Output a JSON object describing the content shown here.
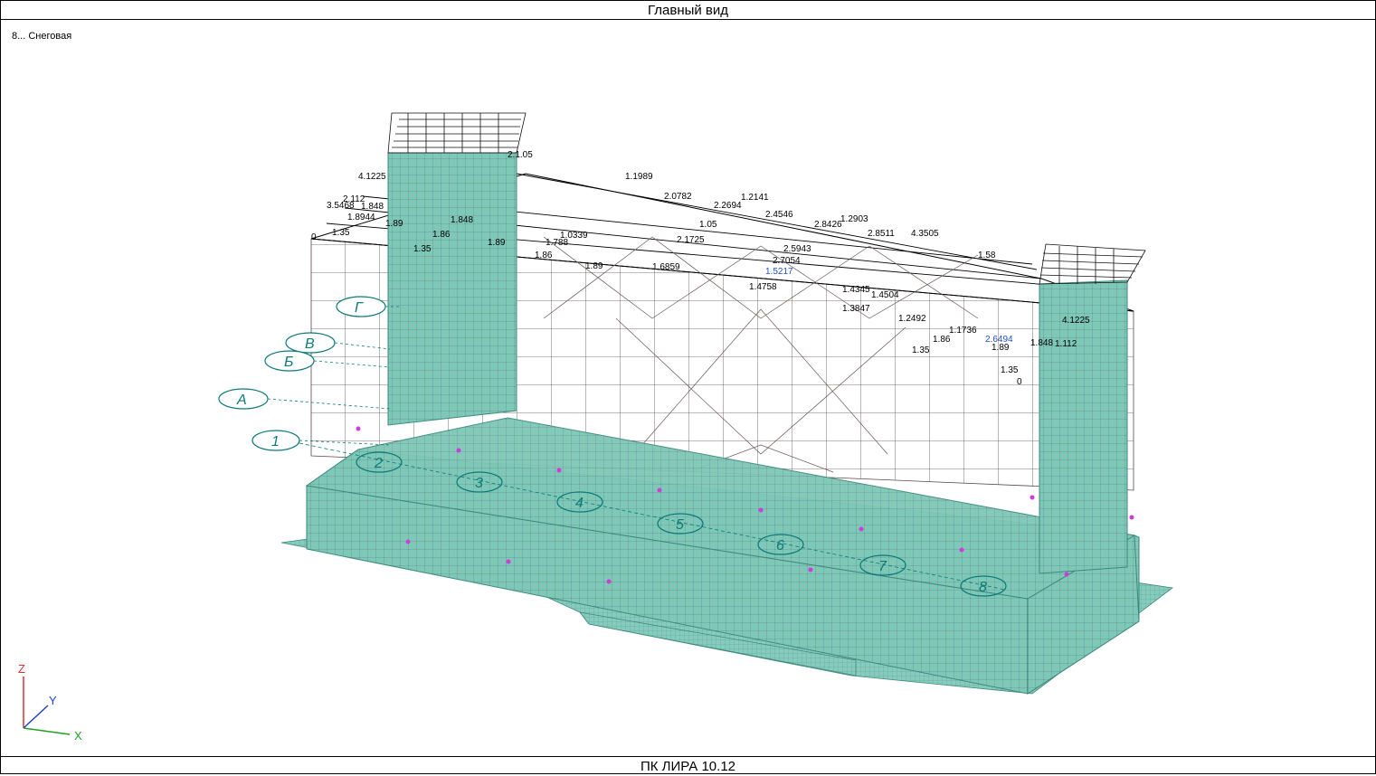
{
  "window": {
    "title": "Главный вид"
  },
  "status": {
    "product": "ПК ЛИРА 10.12"
  },
  "viewport": {
    "load_case": "8... Снеговая",
    "axes": {
      "z": "Z",
      "y": "Y",
      "x": "X",
      "colors": {
        "z": "#e03030",
        "y": "#2040d0",
        "x": "#20a020"
      }
    },
    "grid_axes_letters": [
      "Г",
      "В",
      "Б",
      "А"
    ],
    "grid_axes_numbers": [
      "1",
      "2",
      "3",
      "4",
      "5",
      "6",
      "7",
      "8"
    ],
    "load_values": [
      "4.1225",
      "3.5468",
      "2.112",
      "1.848",
      "1.8944",
      "1.89",
      "1.35",
      "0",
      "1.35",
      "1.848",
      "1.86",
      "1.89",
      "2.1.05",
      "1.1989",
      "2.0782",
      "1.2141",
      "2.2694",
      "2.4546",
      "1.2903",
      "2.8426",
      "2.8511",
      "4.3505",
      "1.05",
      "2.1725",
      "1.788",
      "1.86",
      "1.89",
      "1.6859",
      "1.0339",
      "1.4758",
      "1.5217",
      "2.7054",
      "2.5943",
      "1.4345",
      "1.4504",
      "1.3847",
      "1.2492",
      "1.1736",
      "1.58",
      "1.35",
      "1.86",
      "1.89",
      "2.6494",
      "1.848",
      "1.112",
      "4.1225",
      "1.35",
      "0"
    ],
    "colors": {
      "mesh_fill": "#7fc7b6",
      "mesh_line": "#3d8a7d",
      "node": "#d23bd9",
      "frame": "#5a4848",
      "grid": "#0b7a78"
    }
  }
}
